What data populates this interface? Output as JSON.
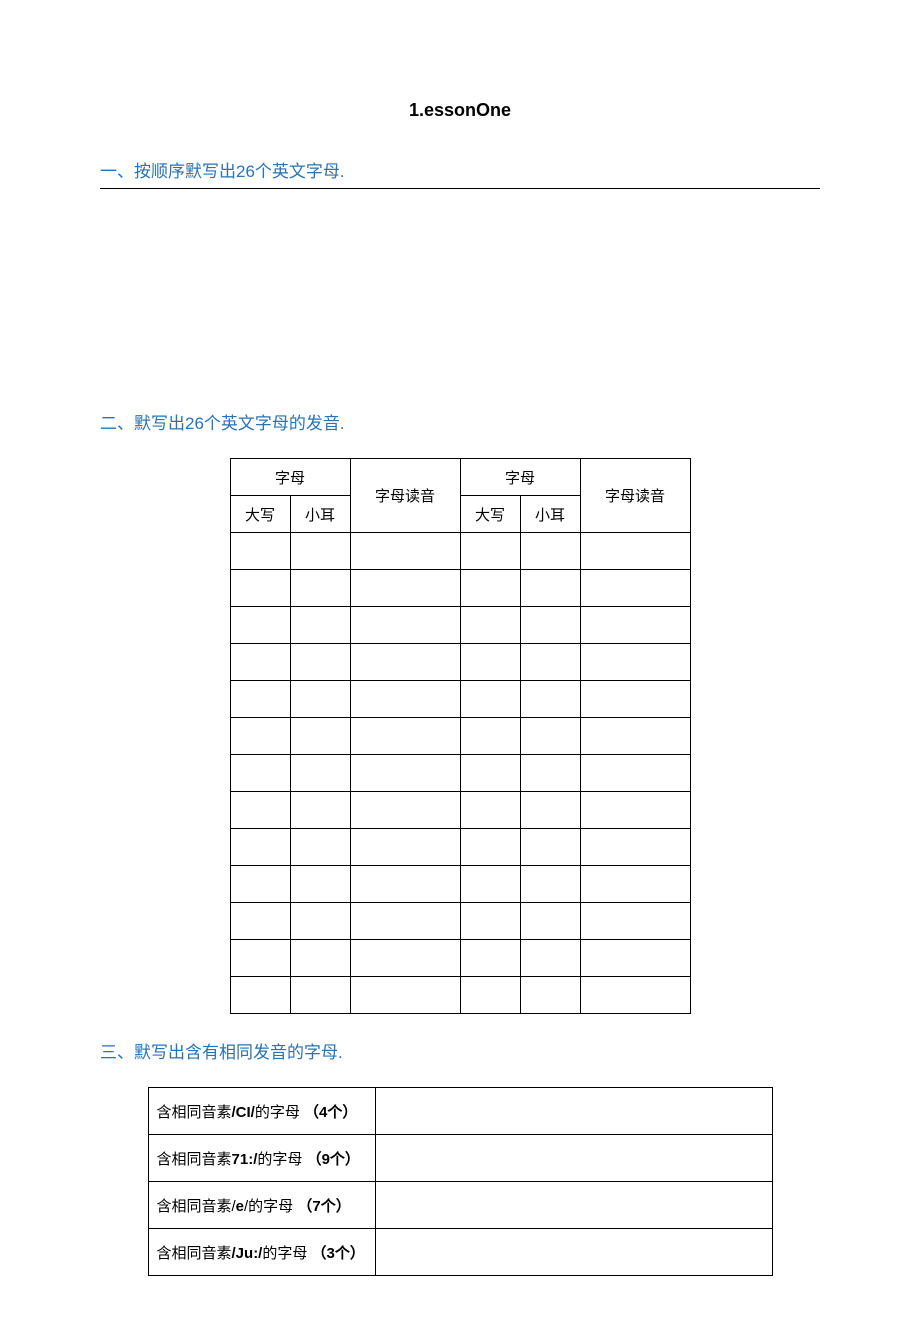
{
  "title": "1.essonOne",
  "section1": {
    "heading": "一、按顺序默写出26个英文字母."
  },
  "section2": {
    "heading": "二、默写出26个英文字母的发音.",
    "table_headers": {
      "letter_group": "字母",
      "pron": "字母读音",
      "upper": "大写",
      "lower": "小耳"
    },
    "rows_count": 13
  },
  "section3": {
    "heading": "三、默写出含有相同发音的字母.",
    "rows": [
      {
        "prefix": "含相同音素",
        "code": "/CI/",
        "mid": "的字母",
        "count": "（4个）"
      },
      {
        "prefix": "含相同音素",
        "code": "71:/",
        "mid": "的字母",
        "count": "（9个）"
      },
      {
        "prefix": "含相同音素/",
        "code": "e",
        "mid": "/的字母",
        "count": "（7个）"
      },
      {
        "prefix": "含相同音素",
        "code": "/Ju:/",
        "mid": "的字母",
        "count": "（3个）"
      }
    ]
  }
}
